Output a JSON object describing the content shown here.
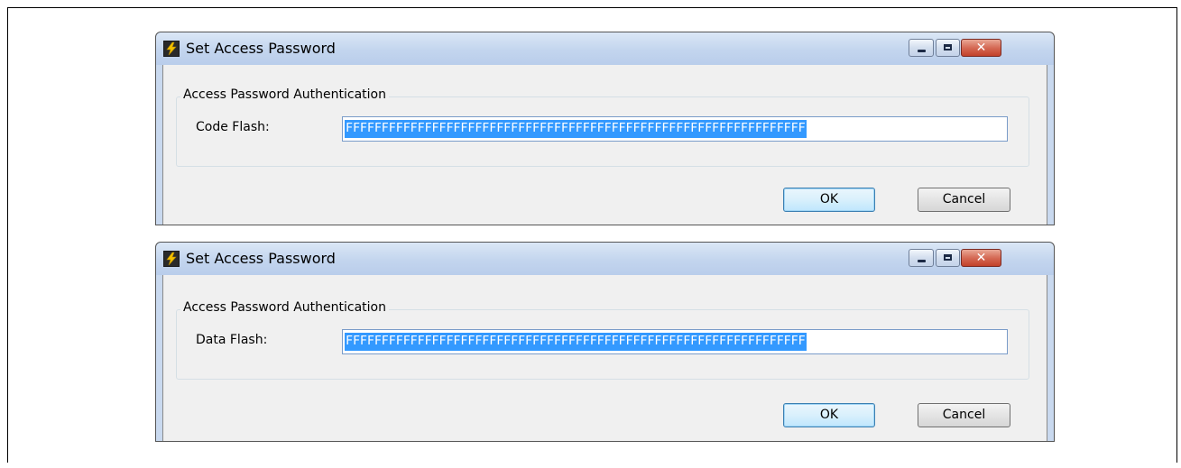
{
  "dialogs": [
    {
      "title": "Set Access Password",
      "window_controls": [
        "minimize-icon",
        "maximize-icon",
        "close-icon"
      ],
      "close_glyph": "✕",
      "group_label": "Access Password Authentication",
      "field_label": "Code Flash:",
      "field_value": "FFFFFFFFFFFFFFFFFFFFFFFFFFFFFFFFFFFFFFFFFFFFFFFFFFFFFFFFFFFFFFFF",
      "ok_label": "OK",
      "cancel_label": "Cancel"
    },
    {
      "title": "Set Access Password",
      "window_controls": [
        "minimize-icon",
        "maximize-icon",
        "close-icon"
      ],
      "close_glyph": "✕",
      "group_label": "Access Password Authentication",
      "field_label": "Data Flash:",
      "field_value": "FFFFFFFFFFFFFFFFFFFFFFFFFFFFFFFFFFFFFFFFFFFFFFFFFFFFFFFFFFFFFFFF",
      "ok_label": "OK",
      "cancel_label": "Cancel"
    }
  ],
  "colors": {
    "titlebar": "#c3d5ee",
    "selection": "#3399ff",
    "client_bg": "#f0f0f0",
    "close_button": "#c2412a"
  }
}
